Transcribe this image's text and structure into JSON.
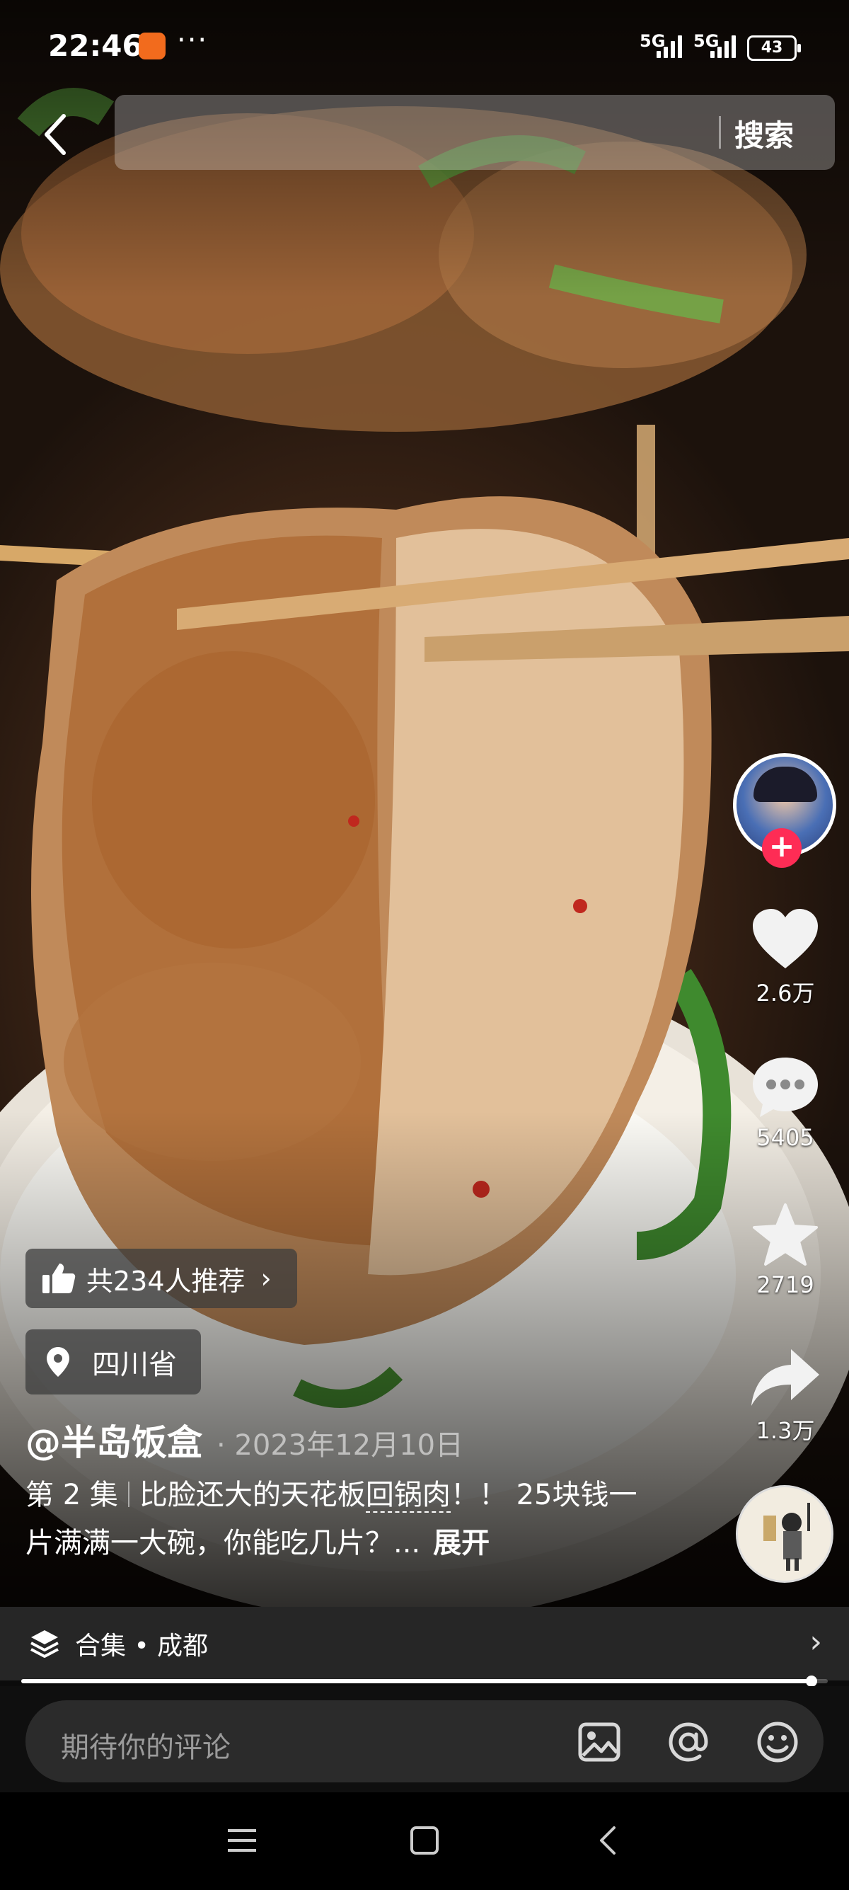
{
  "status_bar": {
    "time": "22:46",
    "network1": "5G",
    "network2": "5G",
    "battery": "43"
  },
  "top_bar": {
    "search_button": "搜索"
  },
  "right_rail": {
    "likes": "2.6万",
    "comments": "5405",
    "favorites": "2719",
    "shares": "1.3万"
  },
  "video_info": {
    "recommend": "共234人推荐",
    "location": "四川省",
    "author": "@半岛饭盒",
    "date": "· 2023年12月10日",
    "episode": "第 2 集",
    "caption_a": "比脸还大的天花板",
    "caption_keyword": "回锅肉",
    "caption_b": "！！ 25块钱一片满满一大碗，你能吃几片？...",
    "expand": "展开"
  },
  "collection": {
    "label": "合集 • 成都"
  },
  "playback": {
    "progress": 0.98
  },
  "comment_bar": {
    "placeholder": "期待你的评论"
  },
  "icons": {
    "back": "chevron-left-icon",
    "like": "heart-icon",
    "comment": "speech-bubble-icon",
    "favorite": "star-icon",
    "share": "share-arrow-icon",
    "location": "map-pin-icon",
    "recommend": "thumbs-up-icon",
    "collection": "layers-icon",
    "image": "image-icon",
    "mention": "at-icon",
    "emoji": "smiley-icon"
  },
  "colors": {
    "follow": "#fe2c55",
    "overlay_chip": "#3c3c3c"
  }
}
